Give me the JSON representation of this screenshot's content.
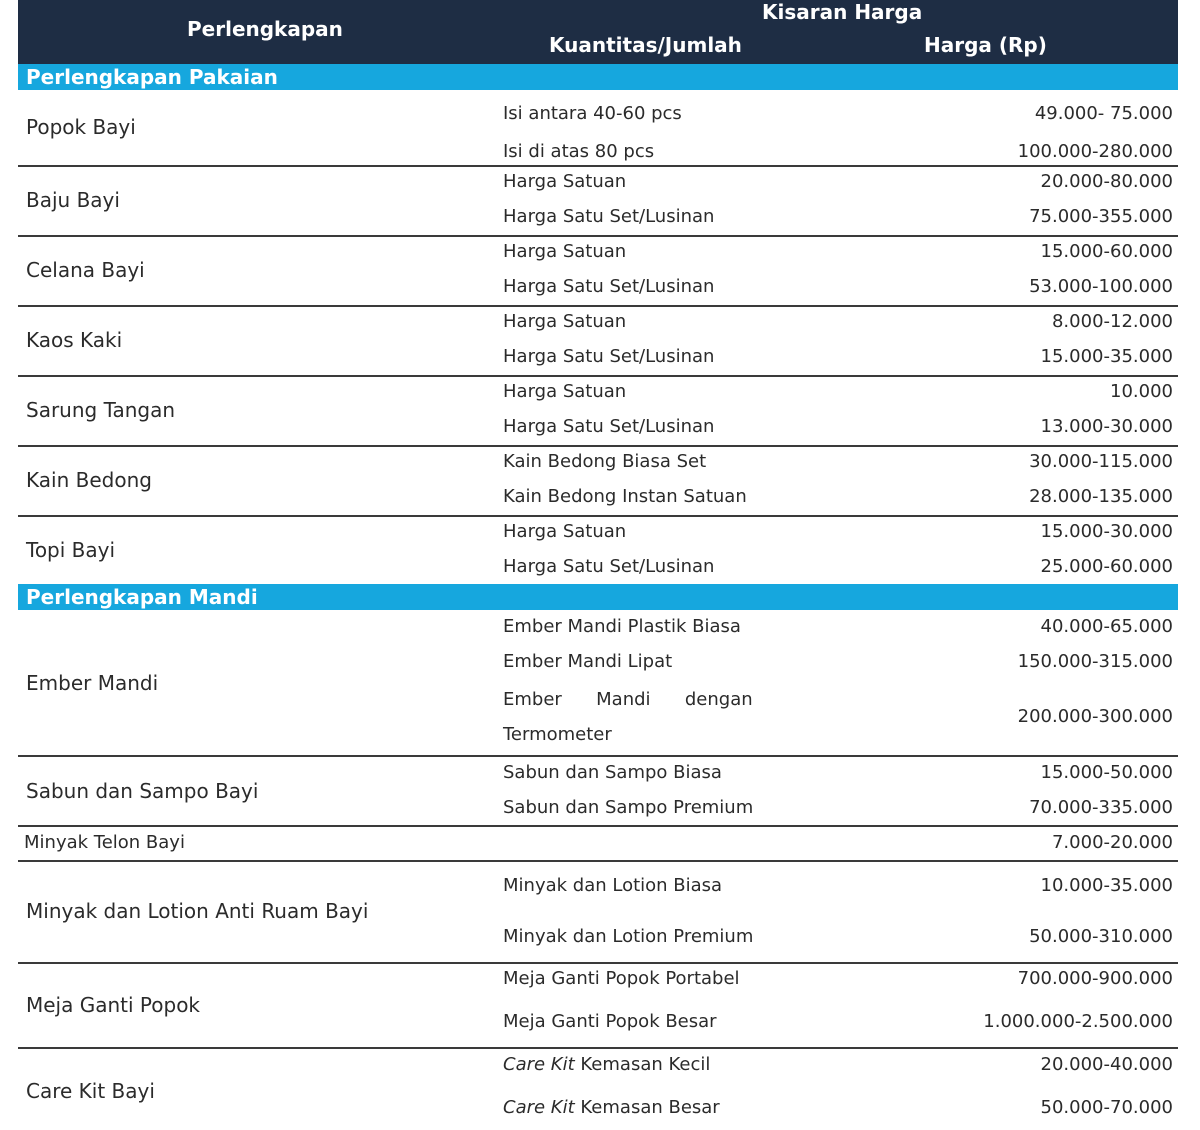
{
  "header": {
    "col_item": "Perlengkapan",
    "group": "Kisaran Harga",
    "col_qty": "Kuantitas/Jumlah",
    "col_price": "Harga (Rp)"
  },
  "sections": [
    {
      "title": "Perlengkapan Pakaian",
      "rows": [
        {
          "item": "Popok Bayi",
          "subs": [
            {
              "label": "Isi antara 40-60 pcs",
              "price": "49.000- 75.000"
            },
            {
              "label": "Isi di atas 80 pcs",
              "price": "100.000-280.000"
            }
          ]
        },
        {
          "item": "Baju Bayi",
          "subs": [
            {
              "label": "Harga Satuan",
              "price": "20.000-80.000"
            },
            {
              "label": "Harga Satu Set/Lusinan",
              "price": "75.000-355.000"
            }
          ]
        },
        {
          "item": "Celana Bayi",
          "subs": [
            {
              "label": "Harga Satuan",
              "price": "15.000-60.000"
            },
            {
              "label": "Harga Satu Set/Lusinan",
              "price": "53.000-100.000"
            }
          ]
        },
        {
          "item": "Kaos Kaki",
          "subs": [
            {
              "label": "Harga Satuan",
              "price": "8.000-12.000"
            },
            {
              "label": "Harga Satu Set/Lusinan",
              "price": "15.000-35.000"
            }
          ]
        },
        {
          "item": "Sarung Tangan",
          "subs": [
            {
              "label": "Harga Satuan",
              "price": "10.000"
            },
            {
              "label": "Harga Satu Set/Lusinan",
              "price": "13.000-30.000"
            }
          ]
        },
        {
          "item": "Kain Bedong",
          "subs": [
            {
              "label": "Kain Bedong Biasa Set",
              "price": "30.000-115.000"
            },
            {
              "label": "Kain Bedong Instan Satuan",
              "price": "28.000-135.000"
            }
          ]
        },
        {
          "item": "Topi Bayi",
          "subs": [
            {
              "label": "Harga Satuan",
              "price": "15.000-30.000"
            },
            {
              "label": "Harga Satu Set/Lusinan",
              "price": "25.000-60.000"
            }
          ]
        }
      ]
    },
    {
      "title": "Perlengkapan Mandi",
      "rows": [
        {
          "item": "Ember Mandi",
          "subs": [
            {
              "label": "Ember Mandi Plastik Biasa",
              "price": "40.000-65.000"
            },
            {
              "label": "Ember Mandi Lipat",
              "price": "150.000-315.000"
            },
            {
              "label_line1": "Ember      Mandi      dengan",
              "label_line2": "Termometer",
              "price": "200.000-300.000"
            }
          ]
        },
        {
          "item": "Sabun dan Sampo Bayi",
          "subs": [
            {
              "label": "Sabun dan Sampo Biasa",
              "price": "15.000-50.000"
            },
            {
              "label": "Sabun dan Sampo Premium",
              "price": "70.000-335.000"
            }
          ]
        },
        {
          "item": "Minyak Telon Bayi",
          "subs": [
            {
              "label": "",
              "price": "7.000-20.000"
            }
          ]
        },
        {
          "item": "Minyak dan Lotion Anti Ruam Bayi",
          "subs": [
            {
              "label": "Minyak dan Lotion Biasa",
              "price": "10.000-35.000"
            },
            {
              "label": "Minyak dan Lotion Premium",
              "price": "50.000-310.000"
            }
          ]
        },
        {
          "item": "Meja Ganti Popok",
          "subs": [
            {
              "label": "Meja Ganti Popok Portabel",
              "price": "700.000-900.000"
            },
            {
              "label": "Meja Ganti Popok Besar",
              "price": "1.000.000-2.500.000"
            }
          ]
        },
        {
          "item": "Care Kit Bayi",
          "subs": [
            {
              "label_italic": "Care Kit",
              "label_rest": " Kemasan Kecil",
              "price": "20.000-40.000"
            },
            {
              "label_italic": "Care Kit",
              "label_rest": " Kemasan Besar",
              "price": "50.000-70.000"
            }
          ]
        }
      ]
    }
  ]
}
